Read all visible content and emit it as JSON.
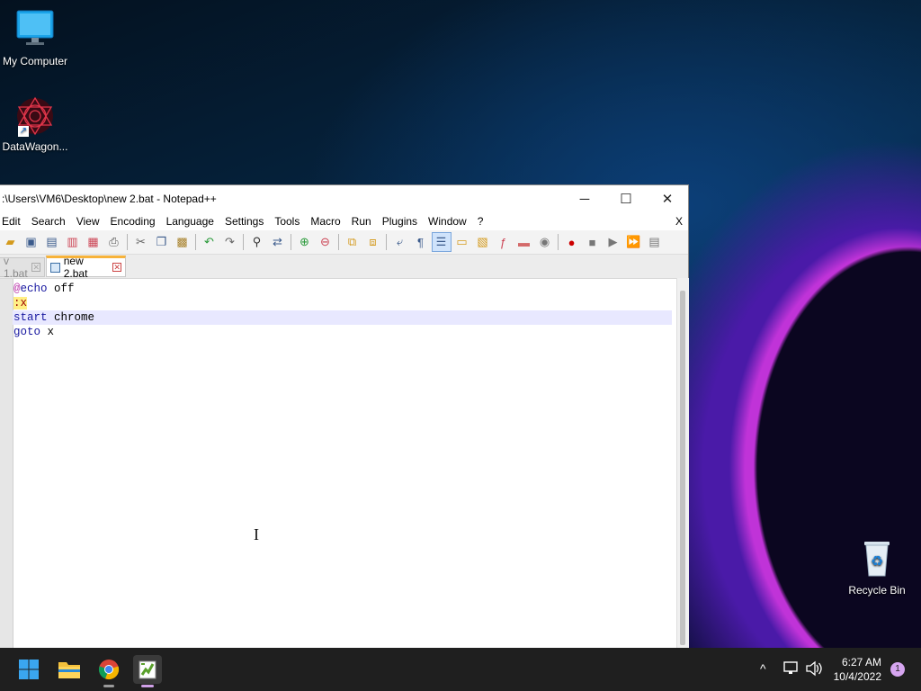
{
  "desktop": {
    "icons": [
      {
        "label": "My Computer"
      },
      {
        "label": "DataWagon..."
      },
      {
        "label": "Recycle Bin"
      }
    ]
  },
  "window": {
    "title": ":\\Users\\VM6\\Desktop\\new 2.bat - Notepad++",
    "controls": {
      "minimize": "─",
      "maximize": "☐",
      "close": "✕"
    },
    "menu": [
      "Edit",
      "Search",
      "View",
      "Encoding",
      "Language",
      "Settings",
      "Tools",
      "Macro",
      "Run",
      "Plugins",
      "Window",
      "?"
    ],
    "menu_close": "X",
    "tabs": [
      {
        "label": "v 1.bat",
        "active": false
      },
      {
        "label": "new 2.bat",
        "active": true
      }
    ],
    "editor": {
      "lines": [
        {
          "at": "@",
          "keyword": "echo",
          "rest": " off"
        },
        {
          "label": ":x"
        },
        {
          "keyword": "start",
          "rest": " chrome"
        },
        {
          "keyword": "goto",
          "rest": " x"
        }
      ],
      "current_line": 3
    }
  },
  "taskbar": {
    "apps": [
      "start-button",
      "file-explorer",
      "chrome",
      "notepad++"
    ],
    "clock": {
      "time": "6:27 AM",
      "date": "10/4/2022"
    },
    "notification_count": "1",
    "tray_chevron": "^"
  },
  "colors": {
    "accent_tab": "#f7b33a",
    "keyword": "#1818a0",
    "label_bg": "#ffef85",
    "current_line": "#e8e8ff"
  }
}
